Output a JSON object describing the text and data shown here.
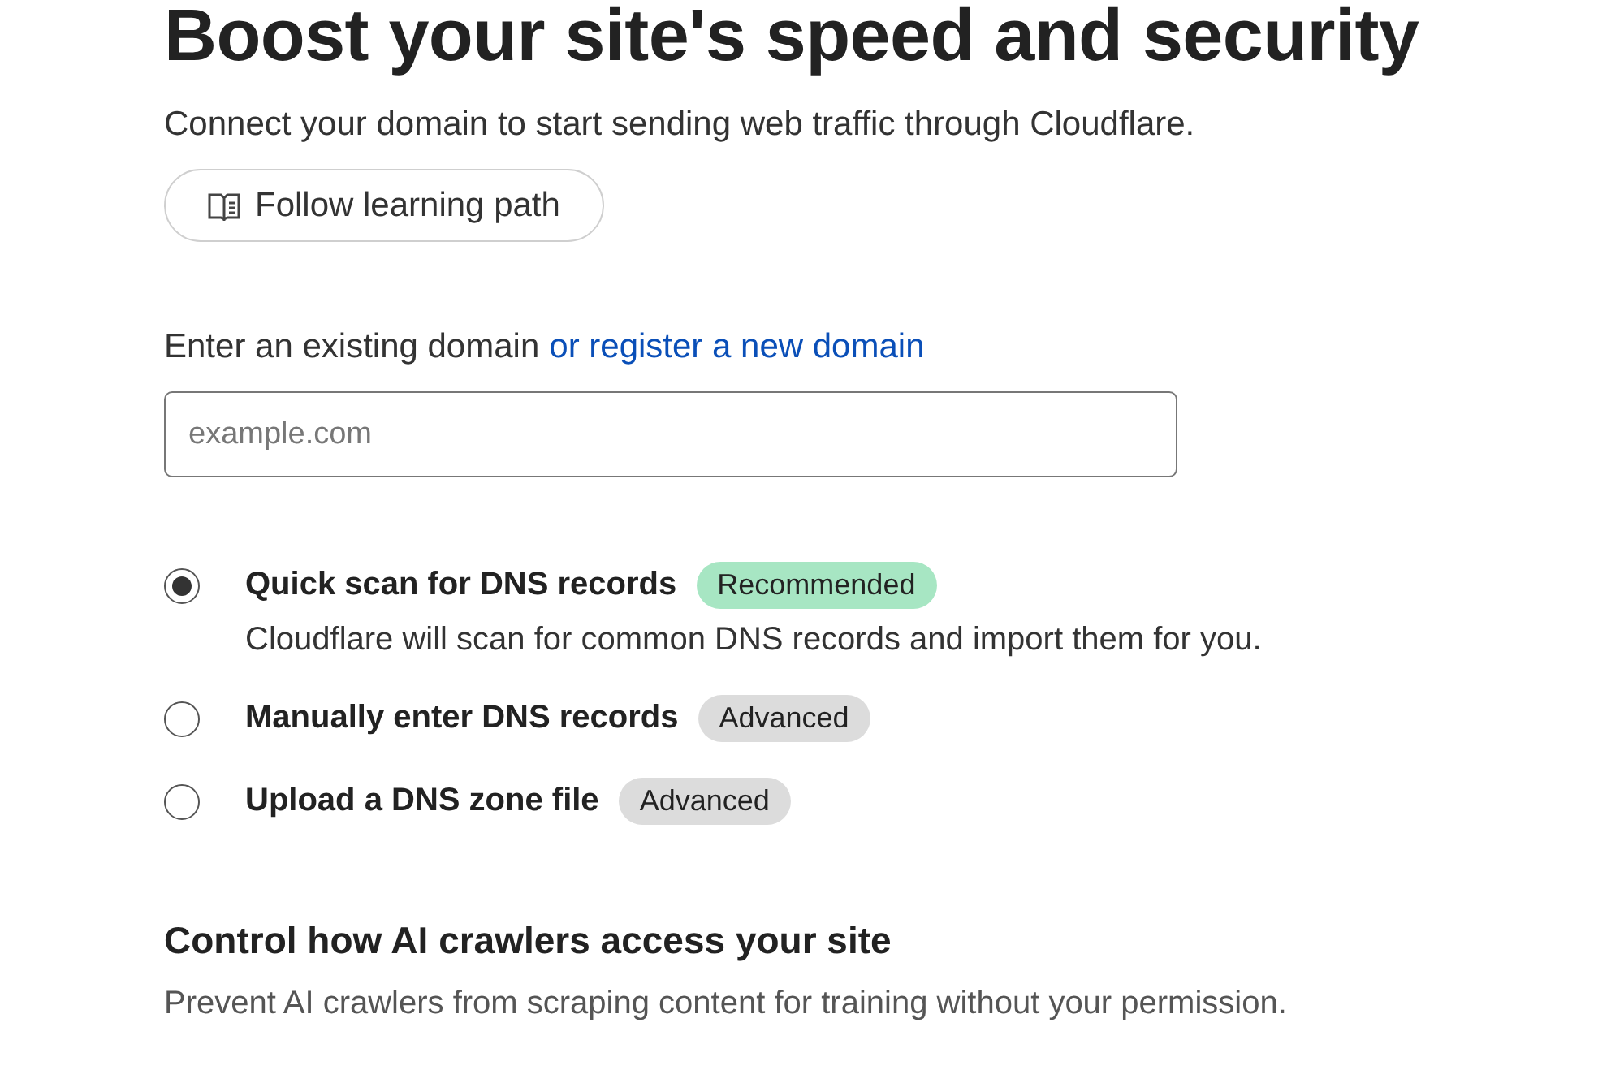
{
  "title": "Boost your site's speed and security",
  "subtitle": "Connect your domain to start sending web traffic through Cloudflare.",
  "learning_button": {
    "label": "Follow learning path"
  },
  "domain_field": {
    "label": "Enter an existing domain",
    "link": "or register a new domain",
    "placeholder": "example.com"
  },
  "options": [
    {
      "label": "Quick scan for DNS records",
      "selected": true,
      "badge": {
        "label": "Recommended",
        "color": "#a7e6c3"
      },
      "description": "Cloudflare will scan for common DNS records and import them for you."
    },
    {
      "label": "Manually enter DNS records",
      "selected": false,
      "badge": {
        "label": "Advanced",
        "color": "#dcdcdc"
      }
    },
    {
      "label": "Upload a DNS zone file",
      "selected": false,
      "badge": {
        "label": "Advanced",
        "color": "#dcdcdc"
      }
    }
  ],
  "ai_section": {
    "heading": "Control how AI crawlers access your site",
    "description": "Prevent AI crawlers from scraping content for training without your permission."
  }
}
